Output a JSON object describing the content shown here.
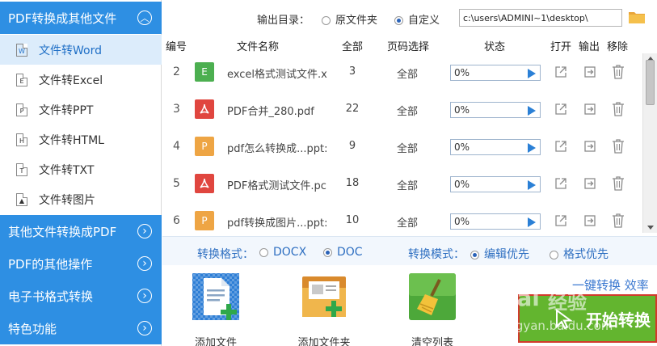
{
  "sidebar": {
    "main_category": "PDF转换成其他文件",
    "sub_items": [
      {
        "label": "文件转Word",
        "icon": "word-file-icon",
        "glyph": "W",
        "active": true
      },
      {
        "label": "文件转Excel",
        "icon": "excel-file-icon",
        "glyph": "E",
        "active": false
      },
      {
        "label": "文件转PPT",
        "icon": "ppt-file-icon",
        "glyph": "P",
        "active": false
      },
      {
        "label": "文件转HTML",
        "icon": "html-file-icon",
        "glyph": "H",
        "active": false
      },
      {
        "label": "文件转TXT",
        "icon": "txt-file-icon",
        "glyph": "T",
        "active": false
      },
      {
        "label": "文件转图片",
        "icon": "image-file-icon",
        "glyph": "▲",
        "active": false
      }
    ],
    "categories": [
      {
        "label": "其他文件转换成PDF"
      },
      {
        "label": "PDF的其他操作"
      },
      {
        "label": "电子书格式转换"
      },
      {
        "label": "特色功能"
      }
    ]
  },
  "topbar": {
    "output_label": "输出目录：",
    "option_original": "原文件夹",
    "option_custom": "自定义",
    "selected": "custom",
    "path_value": "c:\\users\\ADMINI~1\\desktop\\"
  },
  "table": {
    "headers": {
      "index": "编号",
      "name": "文件名称",
      "total": "全部",
      "page_select": "页码选择",
      "status": "状态",
      "open": "打开",
      "output": "输出",
      "remove": "移除"
    },
    "rows": [
      {
        "index": "2",
        "type": "excel",
        "icon_letter": "E",
        "icon_color": "#4caf50",
        "name": "excel格式测试文件.x",
        "total": "3",
        "page_select": "全部",
        "progress_text": "0%",
        "progress": 0
      },
      {
        "index": "3",
        "type": "pdf",
        "icon_letter": "",
        "icon_color": "#e0463f",
        "name": "PDF合并_280.pdf",
        "total": "22",
        "page_select": "全部",
        "progress_text": "0%",
        "progress": 0
      },
      {
        "index": "4",
        "type": "ppt",
        "icon_letter": "P",
        "icon_color": "#eea544",
        "name": "pdf怎么转换成...ppt:",
        "total": "9",
        "page_select": "全部",
        "progress_text": "0%",
        "progress": 0
      },
      {
        "index": "5",
        "type": "pdf",
        "icon_letter": "",
        "icon_color": "#e0463f",
        "name": "PDF格式测试文件.pc",
        "total": "18",
        "page_select": "全部",
        "progress_text": "0%",
        "progress": 0
      },
      {
        "index": "6",
        "type": "ppt",
        "icon_letter": "P",
        "icon_color": "#eea544",
        "name": "pdf转换成图片...ppt:",
        "total": "10",
        "page_select": "全部",
        "progress_text": "0%",
        "progress": 0
      }
    ]
  },
  "options": {
    "format_label": "转换格式：",
    "format_docx": "DOCX",
    "format_doc": "DOC",
    "format_selected": "doc",
    "mode_label": "转换模式：",
    "mode_edit": "编辑优先",
    "mode_format": "格式优先",
    "mode_selected": "edit"
  },
  "actions": {
    "add_file": "添加文件",
    "add_folder": "添加文件夹",
    "clear_list": "清空列表",
    "onekey_text": "一键转换  效率",
    "start_button": "开始转换"
  },
  "watermark": {
    "brand": "Bai",
    "brand2": "经验",
    "domain": "jingyan.baidu.com"
  },
  "colors": {
    "sidebar_blue": "#2e8fe3",
    "active_bg": "#dcecfb",
    "start_green": "#63b52f",
    "start_border": "#d23a2c"
  }
}
